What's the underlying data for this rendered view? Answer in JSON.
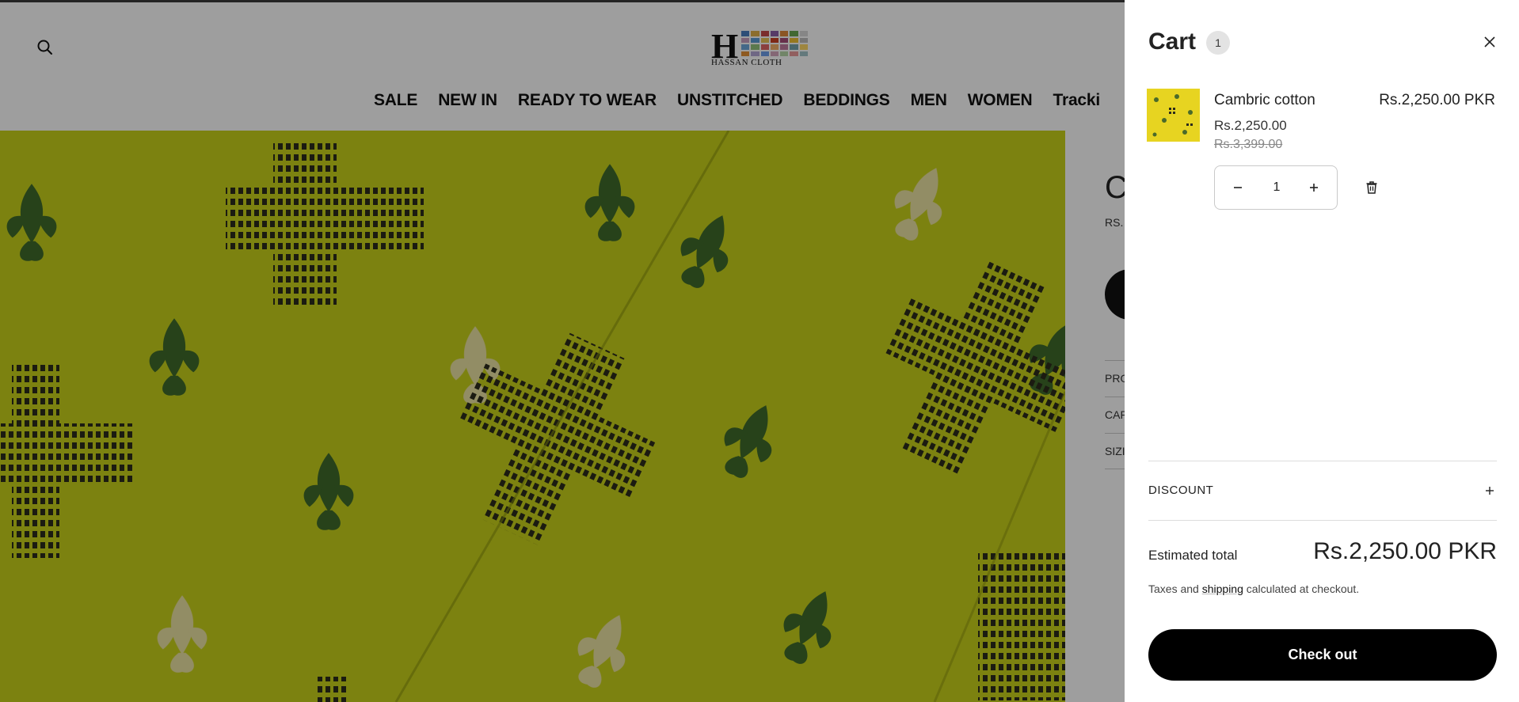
{
  "header": {
    "search_icon": "search-icon",
    "logo_text": "HASSAN CLOTH",
    "logo_letter": "H",
    "nav": [
      "SALE",
      "NEW IN",
      "READY TO WEAR",
      "UNSTITCHED",
      "BEDDINGS",
      "MEN",
      "WOMEN",
      "Tracki"
    ]
  },
  "product": {
    "title_partial": "C",
    "price_partial": "RS.",
    "accordions": [
      "PRO",
      "CAR",
      "SIZI"
    ]
  },
  "cart": {
    "title": "Cart",
    "count": "1",
    "close_icon": "close-icon",
    "item": {
      "name": "Cambric cotton",
      "price": "Rs.2,250.00",
      "compare_price": "Rs.3,399.00",
      "line_total": "Rs.2,250.00 PKR",
      "quantity": "1"
    },
    "discount_label": "DISCOUNT",
    "estimated_total_label": "Estimated total",
    "estimated_total_value": "Rs.2,250.00 PKR",
    "tax_note_before": "Taxes and ",
    "tax_note_link": "shipping",
    "tax_note_after": " calculated at checkout.",
    "checkout_label": "Check out"
  },
  "colors": {
    "fabric": "#c9d21b",
    "motif_green": "#3f6b2a",
    "motif_cream": "#f0e6b4",
    "accent": "#000000"
  }
}
